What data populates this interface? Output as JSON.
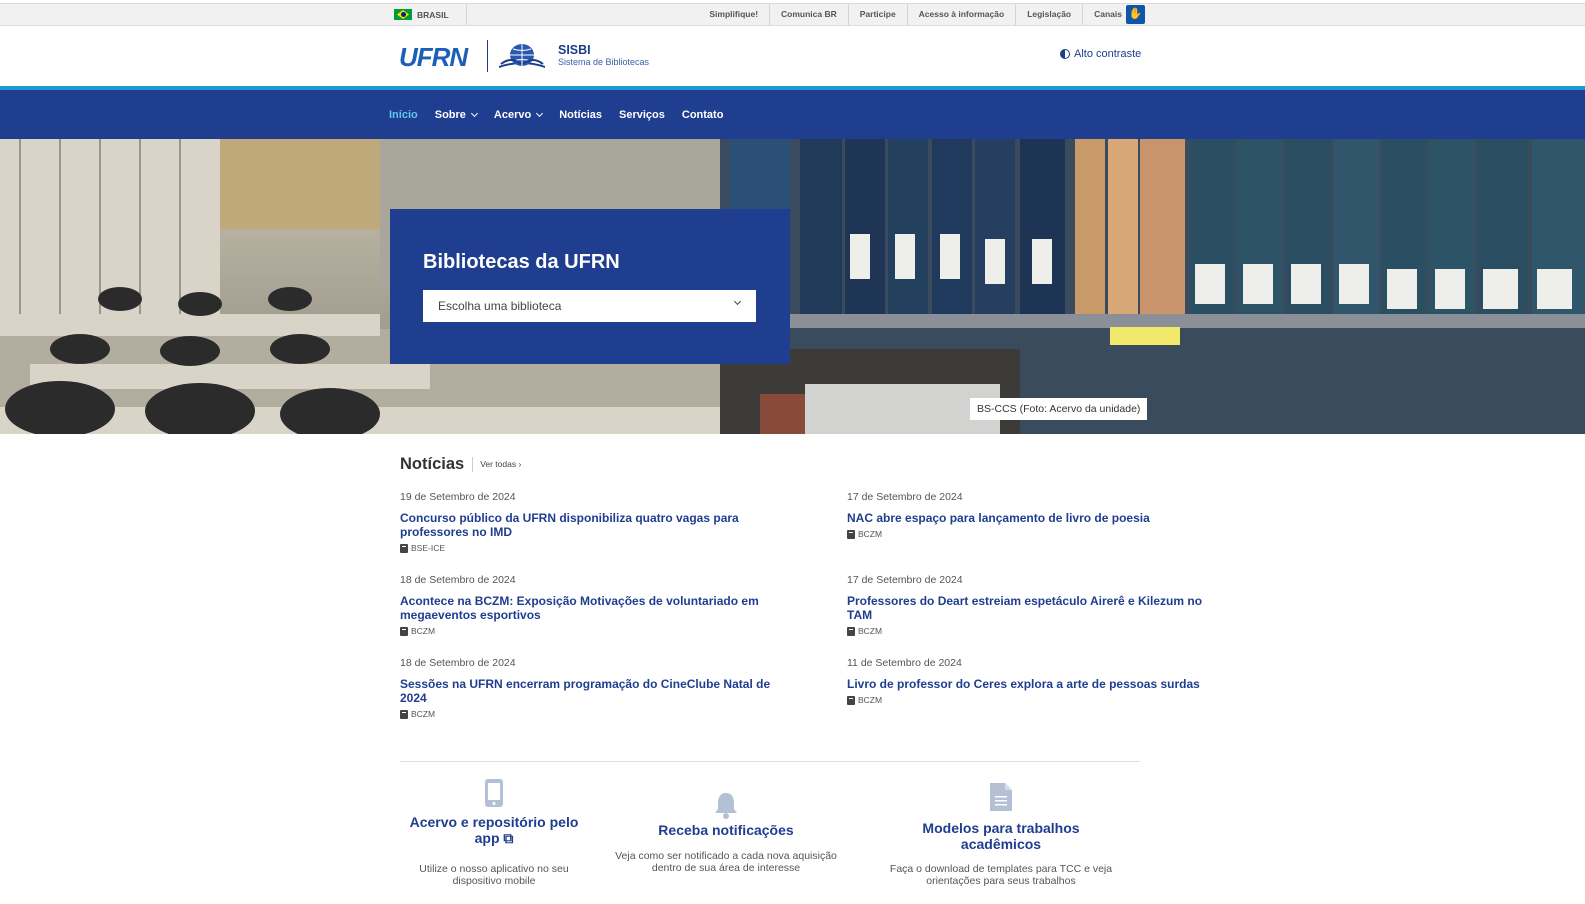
{
  "govbar": {
    "country": "BRASIL",
    "links": [
      "Simplifique!",
      "Comunica BR",
      "Participe",
      "Acesso à informação",
      "Legislação",
      "Canais"
    ]
  },
  "header": {
    "logo_text": "UFRN",
    "sisbi_title": "SISBI",
    "sisbi_subtitle": "Sistema de Bibliotecas",
    "contrast_label": "Alto contraste"
  },
  "nav": {
    "items": [
      "Início",
      "Sobre",
      "Acervo",
      "Notícias",
      "Serviços",
      "Contato"
    ]
  },
  "hero": {
    "title": "Bibliotecas da UFRN",
    "select_placeholder": "Escolha uma biblioteca",
    "caption": "BS-CCS (Foto: Acervo da unidade)"
  },
  "news": {
    "heading": "Notícias",
    "see_all": "Ver todas",
    "items": [
      {
        "date": "19 de Setembro de 2024",
        "title": "Concurso público da UFRN disponibiliza quatro vagas para professores no IMD",
        "tag": "BSE-ICE"
      },
      {
        "date": "17 de Setembro de 2024",
        "title": "NAC abre espaço para lançamento de livro de poesia",
        "tag": "BCZM"
      },
      {
        "date": "18 de Setembro de 2024",
        "title": "Acontece na BCZM: Exposição Motivações de voluntariado em megaeventos esportivos",
        "tag": "BCZM"
      },
      {
        "date": "17 de Setembro de 2024",
        "title": "Professores do Deart estreiam espetáculo Airerê e Kilezum no TAM",
        "tag": "BCZM"
      },
      {
        "date": "18 de Setembro de 2024",
        "title": "Sessões na UFRN encerram programação do CineClube Natal de 2024",
        "tag": "BCZM"
      },
      {
        "date": "11 de Setembro de 2024",
        "title": "Livro de professor do Ceres explora a arte de pessoas surdas",
        "tag": "BCZM"
      }
    ]
  },
  "features": [
    {
      "title": "Acervo e repositório pelo app",
      "desc": "Utilize o nosso aplicativo no seu dispositivo mobile",
      "icon": "mobile-phone-icon"
    },
    {
      "title": "Receba notificações",
      "desc": "Veja como ser notificado a cada nova aquisição dentro de sua área de interesse",
      "icon": "bell-icon"
    },
    {
      "title": "Modelos para trabalhos acadêmicos",
      "desc": "Faça o download de templates para TCC e veja orientações para seus trabalhos",
      "icon": "document-icon"
    }
  ],
  "colors": {
    "primary_blue": "#1f3e8f",
    "accent_cyan": "#1d9ad6",
    "active_nav": "#63c4f0"
  }
}
